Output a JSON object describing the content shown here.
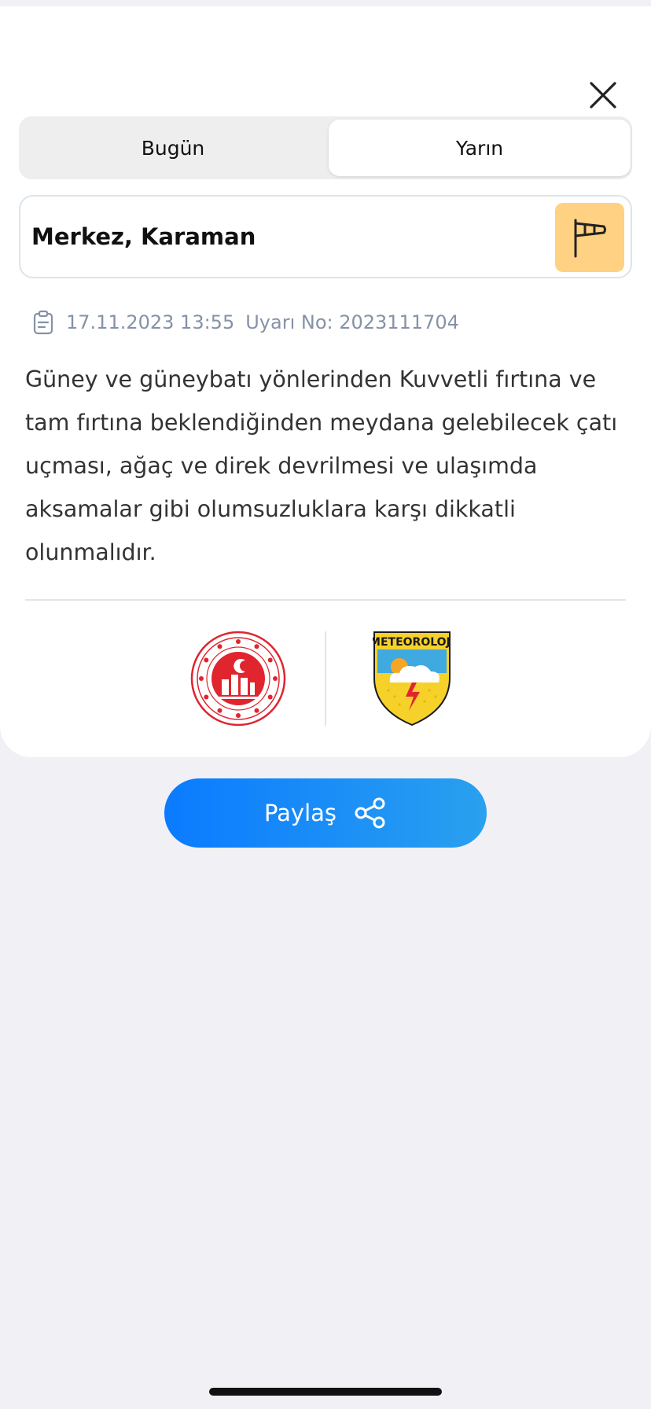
{
  "tabs": [
    {
      "label": "Bugün",
      "selected": false
    },
    {
      "label": "Yarın",
      "selected": true
    }
  ],
  "location": {
    "name": "Merkez, Karaman",
    "badge_icon": "windsock-icon",
    "badge_color": "#ffd182"
  },
  "warning": {
    "datetime": "17.11.2023 13:55",
    "number_label": "Uyarı No: 2023111704",
    "description": "Güney ve güneybatı yönlerinden Kuvvetli fırtına ve tam fırtına beklendiğinden meydana gelebilecek çatı uçması, ağaç ve direk devrilmesi ve ulaşımda aksamalar gibi olumsuzluklara karşı dikkatli olunmalıdır."
  },
  "logos": {
    "left_icon": "ministry-seal-icon",
    "right_icon": "meteoroloji-shield-icon",
    "right_text": "METEOROLOJİ"
  },
  "share": {
    "label": "Paylaş",
    "icon": "share-icon",
    "gradient": [
      "#0a7bff",
      "#2aa0ef"
    ]
  }
}
